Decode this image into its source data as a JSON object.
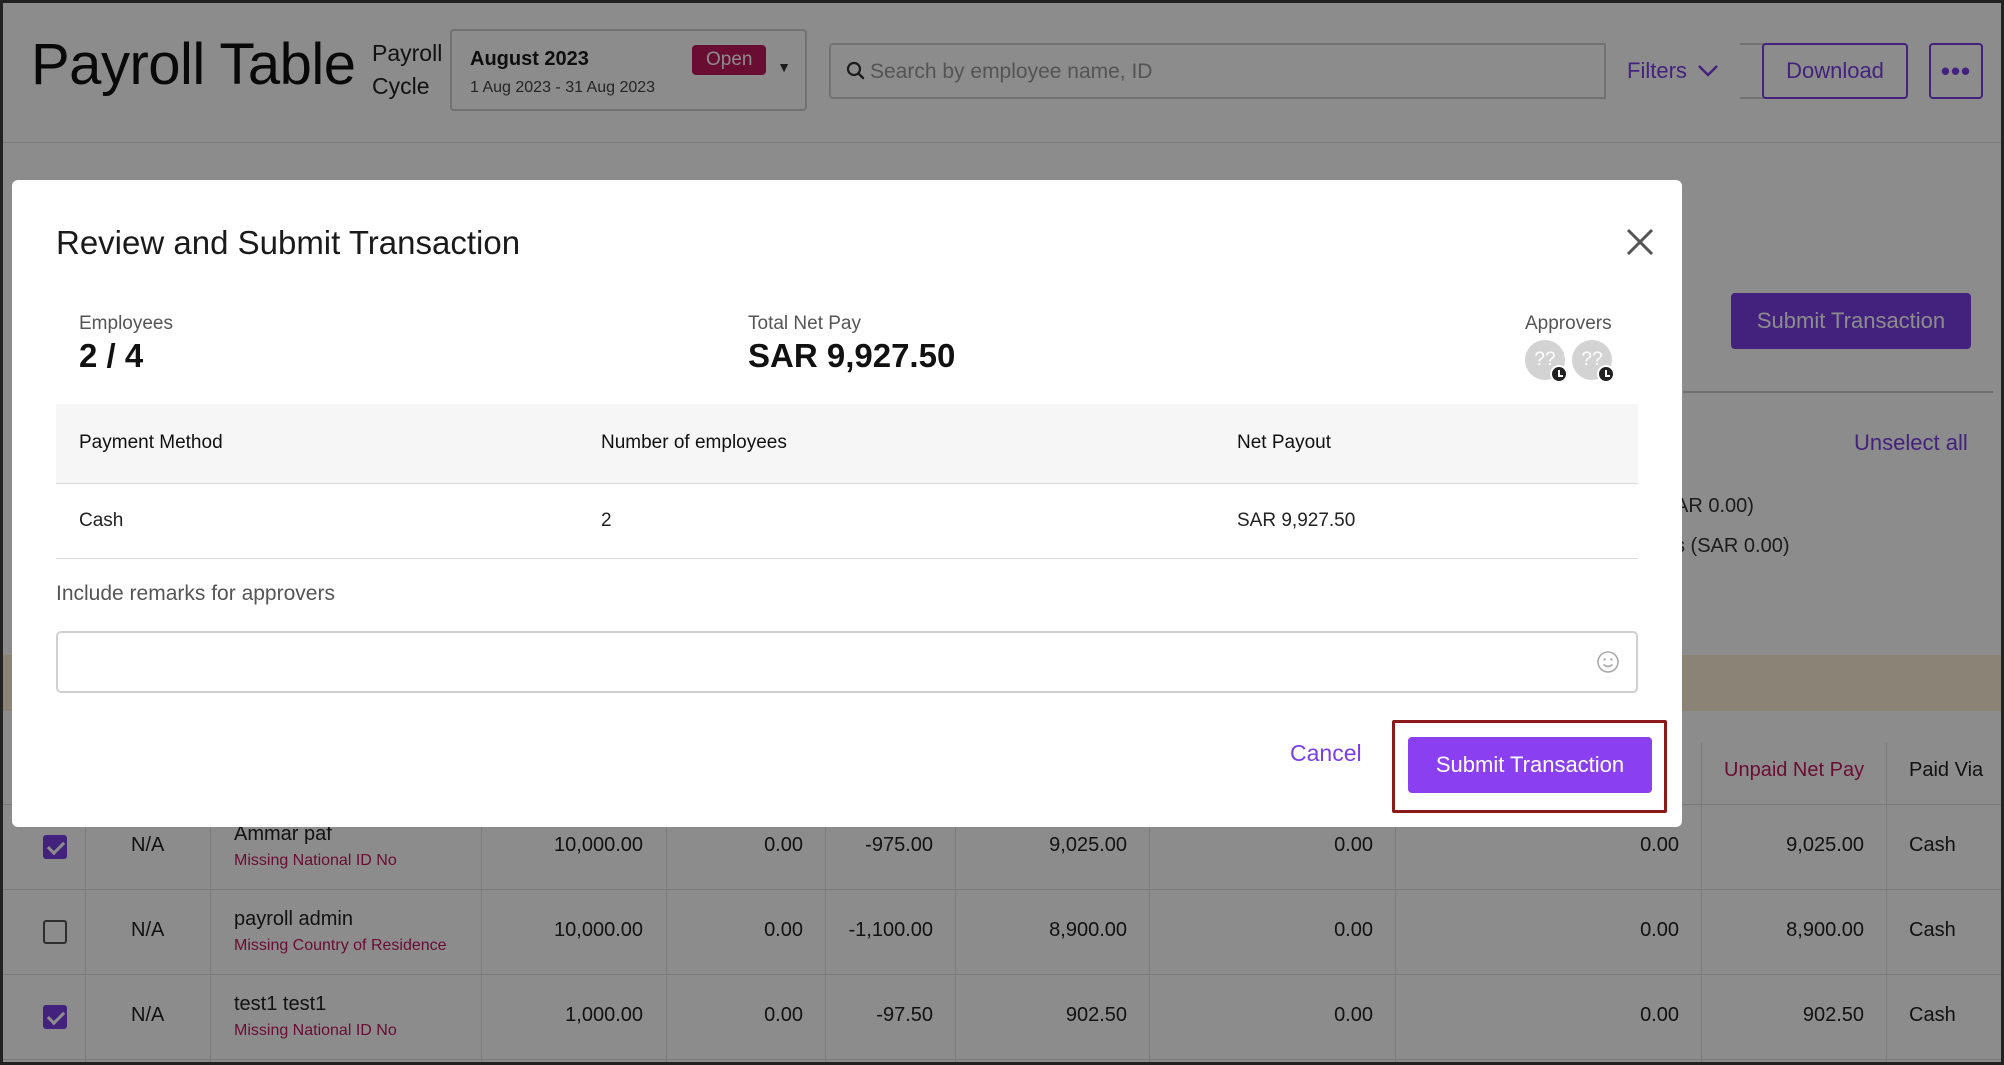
{
  "header": {
    "title": "Payroll Table",
    "cycle_label_line1": "Payroll",
    "cycle_label_line2": "Cycle",
    "cycle_month": "August 2023",
    "cycle_range": "1 Aug 2023 - 31 Aug 2023",
    "cycle_status": "Open",
    "search_placeholder": "Search by employee name, ID",
    "filters_label": "Filters",
    "download_label": "Download",
    "more_label": "•••"
  },
  "background": {
    "submit_label": "Submit Transaction",
    "unselect_all": "Unselect all",
    "summary_line1": "AR 0.00)",
    "summary_line2": "s (SAR 0.00)",
    "table_headers": {
      "unpaid_net_pay": "Unpaid Net Pay",
      "paid_via": "Paid Via"
    },
    "rows": [
      {
        "checked": true,
        "code": "N/A",
        "name": "Ammar paf",
        "warning": "Missing National ID No",
        "c1": "10,000.00",
        "c2": "0.00",
        "c3": "-975.00",
        "c4": "9,025.00",
        "c5": "0.00",
        "c6": "0.00",
        "c7": "9,025.00",
        "paid_via": "Cash"
      },
      {
        "checked": false,
        "code": "N/A",
        "name": "payroll admin",
        "warning": "Missing Country of Residence",
        "c1": "10,000.00",
        "c2": "0.00",
        "c3": "-1,100.00",
        "c4": "8,900.00",
        "c5": "0.00",
        "c6": "0.00",
        "c7": "8,900.00",
        "paid_via": "Cash"
      },
      {
        "checked": true,
        "code": "N/A",
        "name": "test1 test1",
        "warning": "Missing National ID No",
        "c1": "1,000.00",
        "c2": "0.00",
        "c3": "-97.50",
        "c4": "902.50",
        "c5": "0.00",
        "c6": "0.00",
        "c7": "902.50",
        "paid_via": "Cash"
      }
    ]
  },
  "modal": {
    "title": "Review and Submit Transaction",
    "employees_label": "Employees",
    "employees_value": "2 / 4",
    "total_label": "Total Net Pay",
    "total_value": "SAR 9,927.50",
    "approvers_label": "Approvers",
    "approver_placeholder": "??",
    "table": {
      "headers": [
        "Payment Method",
        "Number of employees",
        "Net Payout"
      ],
      "rows": [
        [
          "Cash",
          "2",
          "SAR 9,927.50"
        ]
      ]
    },
    "remarks_label": "Include remarks for approvers",
    "remarks_value": "",
    "cancel_label": "Cancel",
    "submit_label": "Submit Transaction"
  },
  "colors": {
    "accent": "#7a3fe4",
    "badge": "#c2185b",
    "highlight_border": "#8b1a1a"
  }
}
